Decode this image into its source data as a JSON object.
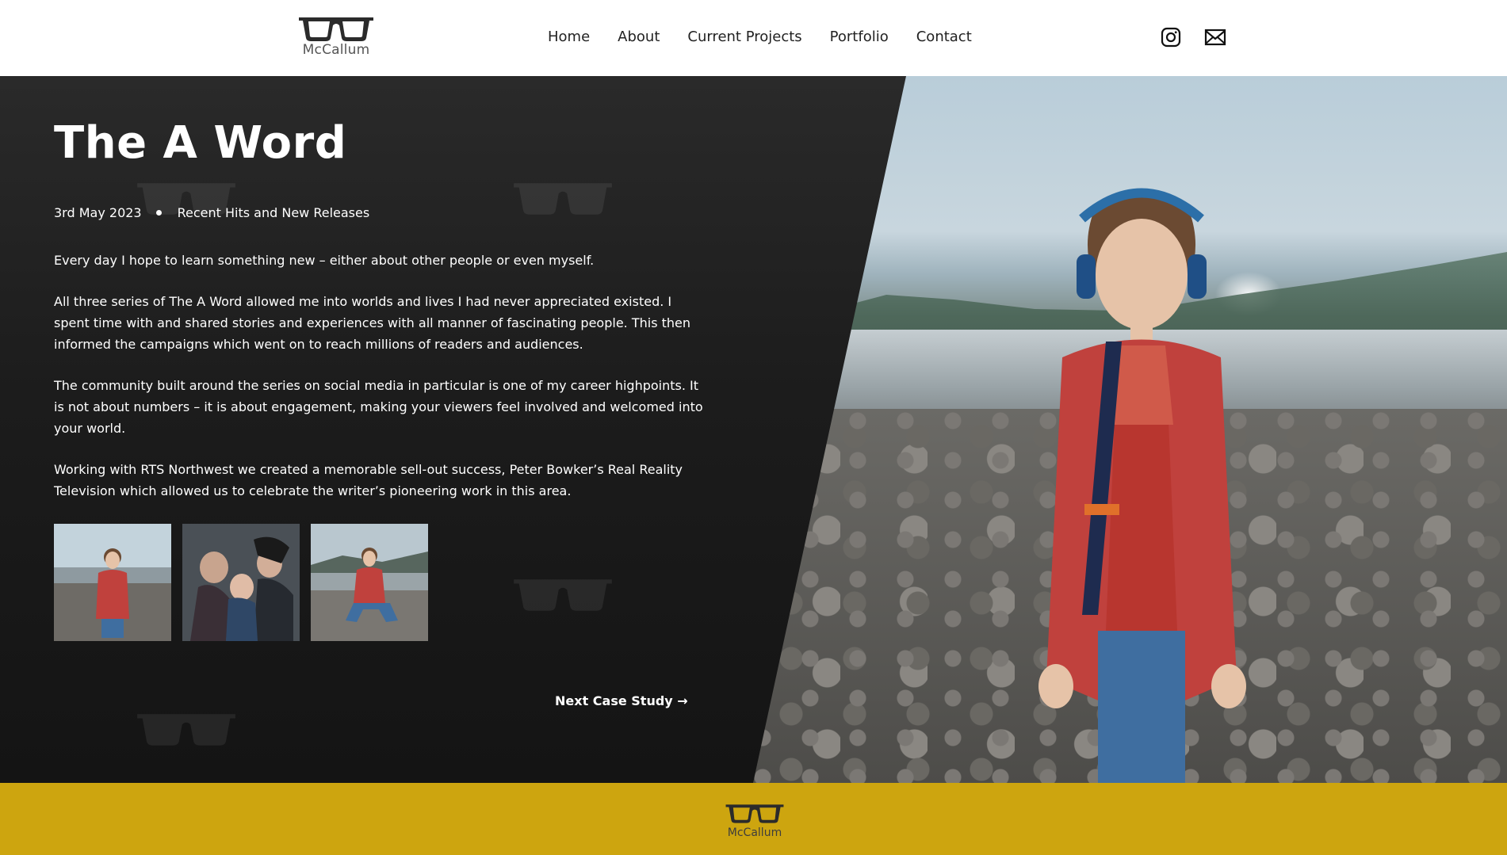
{
  "header": {
    "logo_text": "McCallum",
    "nav": [
      "Home",
      "About",
      "Current Projects",
      "Portfolio",
      "Contact"
    ],
    "social_icons": [
      "instagram-icon",
      "mail-icon"
    ]
  },
  "article": {
    "title": "The A Word",
    "date": "3rd May 2023",
    "category": "Recent Hits and New Releases",
    "paragraphs": [
      "Every day I hope to learn something new – either about other people or even myself.",
      "All three series of The A Word allowed me into worlds and lives I had never appreciated existed. I spent time with and shared stories and experiences with all manner of fascinating people. This then informed the campaigns which went on to reach millions of readers and audiences.",
      "The community built around the series on social media in particular is one of my career highpoints. It is not about numbers – it is about engagement, making your viewers feel involved and welcomed into your world.",
      "Working with RTS Northwest we created a memorable sell-out success, Peter Bowker’s Real Reality Television which allowed us to celebrate the writer’s pioneering work in this area."
    ],
    "next_link": "Next Case Study →"
  },
  "footer": {
    "logo_text": "McCallum"
  },
  "colors": {
    "panel": "#1c1c1c",
    "footer": "#cda50f",
    "text_light": "#ffffff"
  }
}
